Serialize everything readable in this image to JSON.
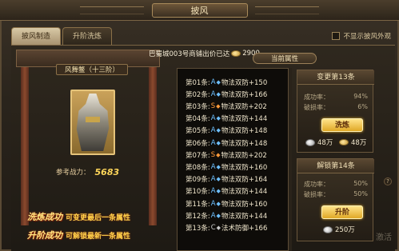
{
  "window": {
    "title": "披风"
  },
  "tabs": [
    {
      "label": "披风制造"
    },
    {
      "label": "升阶洗炼"
    }
  ],
  "hide_option": {
    "label": "不显示披风外观"
  },
  "item": {
    "name": "风舞鳖（十三阶）",
    "power_label": "参考战力：",
    "power_value": "5683"
  },
  "sale_info": {
    "text": "巴蜀城003号商铺出价已达",
    "amount": "2900"
  },
  "attributes": {
    "header": "当前属性",
    "rows": [
      {
        "idx": "第01条:",
        "grade": "A",
        "text": "物法双防+150",
        "gc": "gA"
      },
      {
        "idx": "第02条:",
        "grade": "A",
        "text": "物法双防+166",
        "gc": "gA"
      },
      {
        "idx": "第03条:",
        "grade": "S",
        "text": "物法双防+202",
        "gc": "gS"
      },
      {
        "idx": "第04条:",
        "grade": "A",
        "text": "物法双防+144",
        "gc": "gA"
      },
      {
        "idx": "第05条:",
        "grade": "A",
        "text": "物法双防+148",
        "gc": "gA"
      },
      {
        "idx": "第06条:",
        "grade": "A",
        "text": "物法双防+148",
        "gc": "gA"
      },
      {
        "idx": "第07条:",
        "grade": "S",
        "text": "物法双防+202",
        "gc": "gS"
      },
      {
        "idx": "第08条:",
        "grade": "A",
        "text": "物法双防+160",
        "gc": "gA"
      },
      {
        "idx": "第09条:",
        "grade": "A",
        "text": "物法双防+164",
        "gc": "gA"
      },
      {
        "idx": "第10条:",
        "grade": "A",
        "text": "物法双防+144",
        "gc": "gA"
      },
      {
        "idx": "第11条:",
        "grade": "A",
        "text": "物法双防+160",
        "gc": "gA"
      },
      {
        "idx": "第12条:",
        "grade": "A",
        "text": "物法双防+144",
        "gc": "gA"
      },
      {
        "idx": "第13条:",
        "grade": "C",
        "text": "法术防御+166",
        "gc": "gC"
      }
    ]
  },
  "refine": {
    "title": "变更第13条",
    "success_label": "成功率：",
    "success_value": "94%",
    "break_label": "破损率：",
    "break_value": "6%",
    "button": "洗炼",
    "cost1": "48万",
    "cost2": "48万"
  },
  "unlock": {
    "title": "解锁第14条",
    "success_label": "成功率：",
    "success_value": "50%",
    "break_label": "破损率：",
    "break_value": "50%",
    "button": "升阶",
    "cost": "250万"
  },
  "promos": [
    {
      "head": "洗炼成功",
      "desc": "可变更最后一条属性"
    },
    {
      "head": "升阶成功",
      "desc": "可解锁最新一条属性"
    }
  ],
  "watermark": "激活",
  "help": "?"
}
